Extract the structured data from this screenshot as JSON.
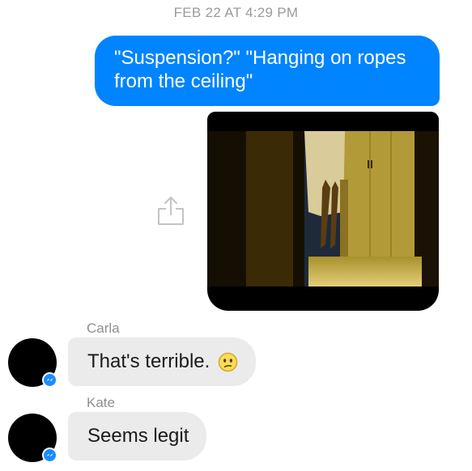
{
  "thread": {
    "timestamp": "FEB 22 AT 4:29 PM"
  },
  "messages": [
    {
      "direction": "outgoing",
      "text": "\"Suspension?\" \"Hanging on ropes from the ceiling\""
    },
    {
      "direction": "outgoing",
      "type": "video",
      "share_icon": "share-icon"
    },
    {
      "direction": "incoming",
      "sender": "Carla",
      "text": "That's terrible.",
      "emoji": "confused-face-icon",
      "avatar_badge": "messenger-icon"
    },
    {
      "direction": "incoming",
      "sender": "Kate",
      "text": "Seems legit",
      "avatar_badge": "messenger-icon"
    }
  ],
  "colors": {
    "outgoing_bubble": "#0084ff",
    "incoming_bubble": "#ebebeb",
    "timestamp_text": "#9a9a9a",
    "messenger_badge": "#1a8cff"
  }
}
